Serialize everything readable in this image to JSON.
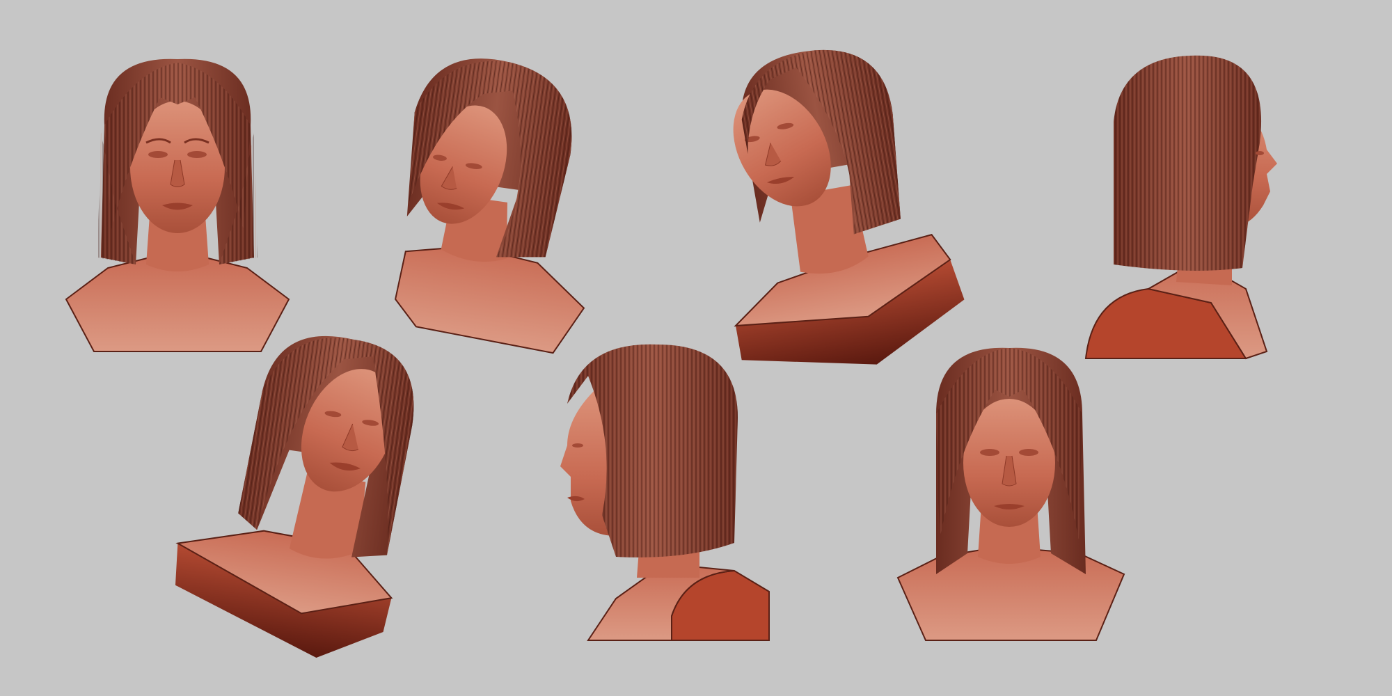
{
  "scene": {
    "background": "#c6c6c6",
    "view_count": 7,
    "colors": {
      "skin_light": "#d98a72",
      "skin_mid": "#c0614a",
      "skin_dark": "#8e3a28",
      "hair_light": "#a25a45",
      "hair_mid": "#7d3b2b",
      "hair_dark": "#4f1f16",
      "base_cut": "#b24830",
      "base_shadow": "#5c1a10",
      "outline": "#3a120c"
    },
    "views": [
      {
        "id": "front",
        "row": 1
      },
      {
        "id": "three-quarter-down-right",
        "row": 1
      },
      {
        "id": "three-quarter-up-left",
        "row": 1
      },
      {
        "id": "profile-right",
        "row": 1
      },
      {
        "id": "three-quarter-up-right",
        "row": 2
      },
      {
        "id": "three-quarter-left",
        "row": 2
      },
      {
        "id": "front-tilted",
        "row": 2
      }
    ]
  }
}
